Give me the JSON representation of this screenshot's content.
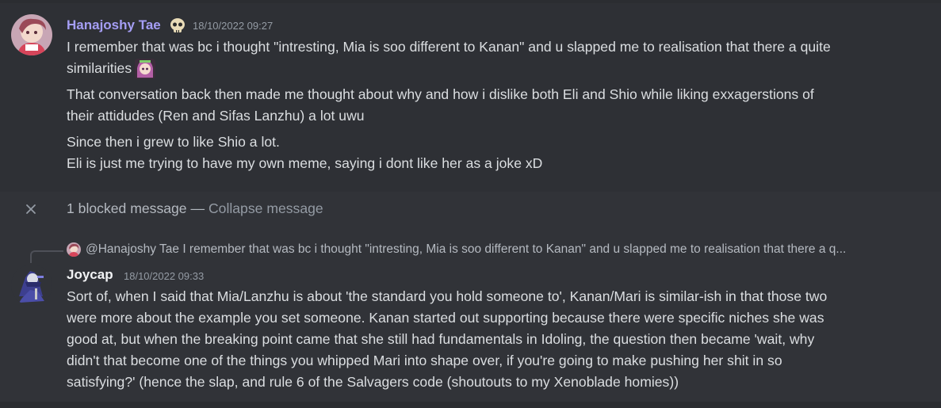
{
  "messages": [
    {
      "username": "Hanajoshy Tae",
      "badge_icon": "skull-emoji-icon",
      "timestamp": "18/10/2022 09:27",
      "lines": [
        "I remember that was bc i thought \"intresting, Mia is soo different to Kanan\" and u slapped me to realisation that there a quite",
        "similarities",
        "That conversation back then made me thought about why and how i dislike both Eli and Shio while liking exxagerstions of",
        "their attidudes (Ren and Sifas Lanzhu) a lot uwu",
        "Since then i grew to like Shio a lot.",
        "Eli is just me trying to have my own meme, saying i dont like her as a joke xD"
      ]
    },
    {
      "username": "Joycap",
      "timestamp": "18/10/2022 09:33",
      "reply": {
        "mention": "@Hanajoshy Tae",
        "preview": "I remember that was bc i thought \"intresting, Mia is soo different to Kanan\" and u slapped me to realisation that there a q..."
      },
      "lines": [
        "Sort of, when I said that Mia/Lanzhu is about 'the standard you hold someone to', Kanan/Mari is similar-ish in that those two",
        "were more about the example you set someone. Kanan started out supporting because there were specific niches she was",
        "good at, but when the breaking point came that she still had fundamentals in Idoling, the question then became 'wait, why",
        "didn't that become one of the things you whipped Mari into shape over, if you're going to make pushing her shit in so",
        "satisfying?' (hence the slap, and rule 6 of the Salvagers code (shoutouts to my Xenoblade homies))"
      ]
    }
  ],
  "blocked": {
    "text": "1 blocked message — ",
    "collapse_label": "Collapse message"
  },
  "colors": {
    "background": "#313338",
    "highlight_group": "#2e3035",
    "username_1": "#a59ef5",
    "username_2": "#f2f3f5",
    "text": "#dbdee1",
    "muted": "#949ba4"
  }
}
